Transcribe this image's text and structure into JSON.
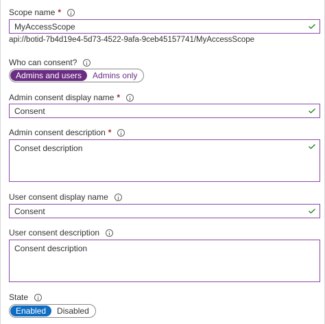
{
  "scope_name": {
    "label": "Scope name",
    "required_mark": "*",
    "value": "MyAccessScope",
    "uri": "api://botid-7b4d19e4-5d73-4522-9afa-9ceb45157741/MyAccessScope"
  },
  "who_can_consent": {
    "label": "Who can consent?",
    "options": [
      "Admins and users",
      "Admins only"
    ],
    "selected": "Admins and users"
  },
  "admin_consent_display_name": {
    "label": "Admin consent display name",
    "required_mark": "*",
    "value": "Consent"
  },
  "admin_consent_description": {
    "label": "Admin consent description",
    "required_mark": "*",
    "value": "Conset description"
  },
  "user_consent_display_name": {
    "label": "User consent display name",
    "value": "Consent"
  },
  "user_consent_description": {
    "label": "User consent description",
    "value": "Consent description"
  },
  "state": {
    "label": "State",
    "options": [
      "Enabled",
      "Disabled"
    ],
    "selected": "Enabled"
  },
  "colors": {
    "field_border": "#8a47a8",
    "toggle_selected_purple": "#6b2d83",
    "toggle_selected_blue": "#0e6dc3",
    "valid_check": "#107c10",
    "required": "#a4262c"
  },
  "icons": [
    "info-icon",
    "check-icon"
  ]
}
